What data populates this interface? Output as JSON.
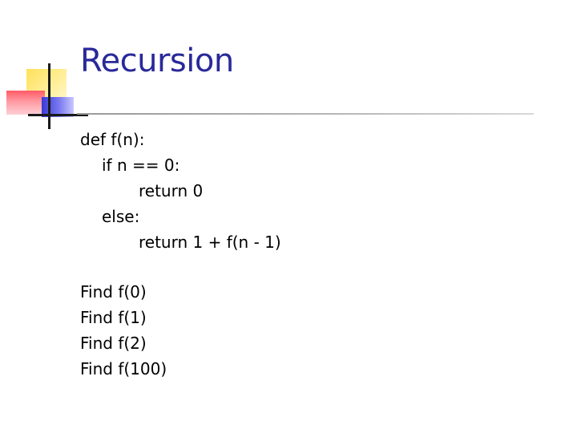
{
  "slide": {
    "title": "Recursion",
    "code": {
      "line1": "def f(n):",
      "line2": "if n == 0:",
      "line3": "return 0",
      "line4": "else:",
      "line5": "return 1 + f(n - 1)"
    },
    "tasks": [
      "Find f(0)",
      "Find f(1)",
      "Find f(2)",
      "Find f(100)"
    ]
  },
  "colors": {
    "title": "#29299a",
    "text": "#000000",
    "accent_yellow": "#ffe15a",
    "accent_red": "#ff5a66",
    "accent_blue": "#3a3ad8"
  }
}
